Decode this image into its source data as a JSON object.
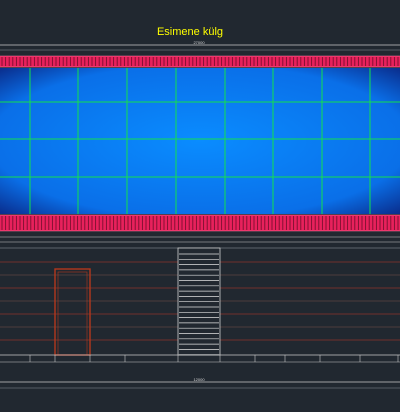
{
  "drawing": {
    "title": "Esimene külg",
    "top_dimension": "27000",
    "bottom_dimension": "12000"
  },
  "colors": {
    "background": "#212830",
    "title": "#ffff00",
    "panel_center": "#0a8cff",
    "panel_edge": "#0a2f8f",
    "grid": "#12e04e",
    "railing": "#e8215c",
    "line": "#c9c9c9",
    "red_line": "#c23a2a",
    "door": "#b4381c"
  },
  "panel": {
    "grid_columns": 8,
    "grid_rows": 4
  }
}
